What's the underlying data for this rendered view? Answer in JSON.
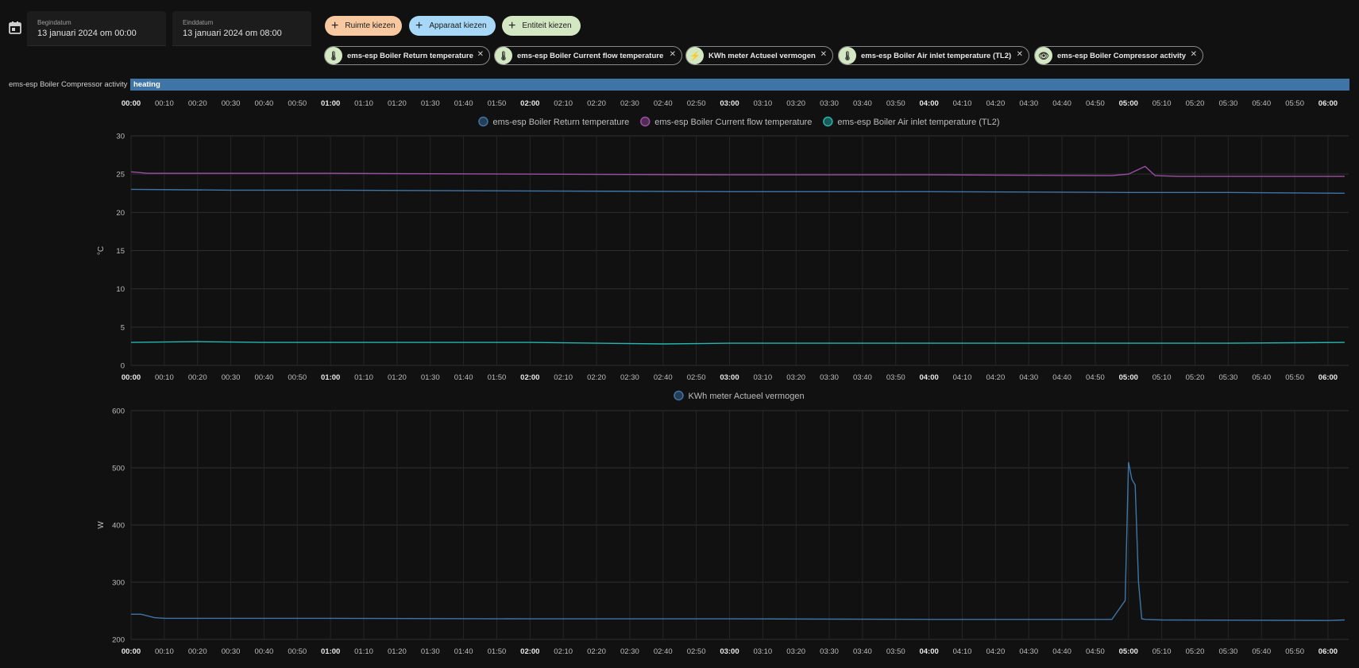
{
  "toolbar": {
    "calendar_icon": "calendar-icon",
    "start": {
      "label": "Begindatum",
      "value": "13 januari 2024 om 00:00"
    },
    "end": {
      "label": "Einddatum",
      "value": "13 januari 2024 om 08:00"
    },
    "buttons": [
      {
        "label": "Ruimte kiezen",
        "color": "#f8c8a0",
        "icon": "plus-icon"
      },
      {
        "label": "Apparaat kiezen",
        "color": "#a7d8f7",
        "icon": "plus-icon"
      },
      {
        "label": "Entiteit kiezen",
        "color": "#d4e7c3",
        "icon": "plus-icon"
      }
    ],
    "chips": [
      {
        "label": "ems-esp Boiler Return temperature",
        "icon": "thermometer-icon"
      },
      {
        "label": "ems-esp Boiler Current flow temperature",
        "icon": "thermometer-icon"
      },
      {
        "label": "KWh meter Actueel vermogen",
        "icon": "flash-icon"
      },
      {
        "label": "ems-esp Boiler Air inlet temperature (TL2)",
        "icon": "thermometer-icon"
      },
      {
        "label": "ems-esp Boiler Compressor activity",
        "icon": "eye-icon"
      }
    ]
  },
  "timeline": {
    "label": "ems-esp Boiler Compressor activity",
    "state": "heating",
    "color": "#3f75a6"
  },
  "time_ticks": [
    "00:00",
    "00:10",
    "00:20",
    "00:30",
    "00:40",
    "00:50",
    "01:00",
    "01:10",
    "01:20",
    "01:30",
    "01:40",
    "01:50",
    "02:00",
    "02:10",
    "02:20",
    "02:30",
    "02:40",
    "02:50",
    "03:00",
    "03:10",
    "03:20",
    "03:30",
    "03:40",
    "03:50",
    "04:00",
    "04:10",
    "04:20",
    "04:30",
    "04:40",
    "04:50",
    "05:00",
    "05:10",
    "05:20",
    "05:30",
    "05:40",
    "05:50",
    "06:00"
  ],
  "chart_data": [
    {
      "type": "line",
      "ylabel": "°C",
      "ylim": [
        0,
        30
      ],
      "yticks": [
        0,
        5,
        10,
        15,
        20,
        25,
        30
      ],
      "x_unit": "time (hh:mm)",
      "grid": true,
      "legend": "top-center",
      "series": [
        {
          "name": "ems-esp Boiler Return temperature",
          "color": "#3f75a6",
          "x": [
            "00:00",
            "00:30",
            "01:00",
            "02:00",
            "03:00",
            "04:00",
            "05:00",
            "05:30",
            "06:05"
          ],
          "values": [
            23.0,
            22.9,
            22.9,
            22.8,
            22.7,
            22.7,
            22.6,
            22.6,
            22.5
          ]
        },
        {
          "name": "ems-esp Boiler Current flow temperature",
          "color": "#9b4fa3",
          "x": [
            "00:00",
            "00:05",
            "00:30",
            "01:00",
            "02:00",
            "03:00",
            "04:00",
            "04:55",
            "05:00",
            "05:05",
            "05:08",
            "05:15",
            "06:05"
          ],
          "values": [
            25.3,
            25.1,
            25.1,
            25.1,
            25.0,
            24.9,
            24.9,
            24.8,
            25.0,
            26.0,
            24.8,
            24.7,
            24.7
          ]
        },
        {
          "name": "ems-esp Boiler Air inlet temperature (TL2)",
          "color": "#26b5b0",
          "x": [
            "00:00",
            "00:20",
            "00:40",
            "01:00",
            "02:00",
            "02:40",
            "03:00",
            "04:00",
            "05:00",
            "05:30",
            "06:05"
          ],
          "values": [
            3.0,
            3.1,
            3.0,
            3.0,
            3.0,
            2.8,
            2.9,
            2.9,
            2.9,
            2.9,
            3.0
          ]
        }
      ]
    },
    {
      "type": "line",
      "ylabel": "W",
      "ylim": [
        200,
        600
      ],
      "yticks": [
        200,
        300,
        400,
        500,
        600
      ],
      "x_unit": "time (hh:mm)",
      "grid": true,
      "legend": "top-center",
      "series": [
        {
          "name": "KWh meter Actueel vermogen",
          "color": "#3f75a6",
          "x": [
            "00:00",
            "00:03",
            "00:07",
            "00:10",
            "01:00",
            "02:00",
            "03:00",
            "04:00",
            "04:55",
            "04:59",
            "05:00",
            "05:01",
            "05:02",
            "05:03",
            "05:04",
            "05:05",
            "05:10",
            "06:00",
            "06:05"
          ],
          "values": [
            244,
            244,
            238,
            237,
            237,
            236,
            236,
            235,
            235,
            268,
            510,
            480,
            470,
            300,
            236,
            235,
            234,
            233,
            234
          ]
        }
      ]
    }
  ]
}
